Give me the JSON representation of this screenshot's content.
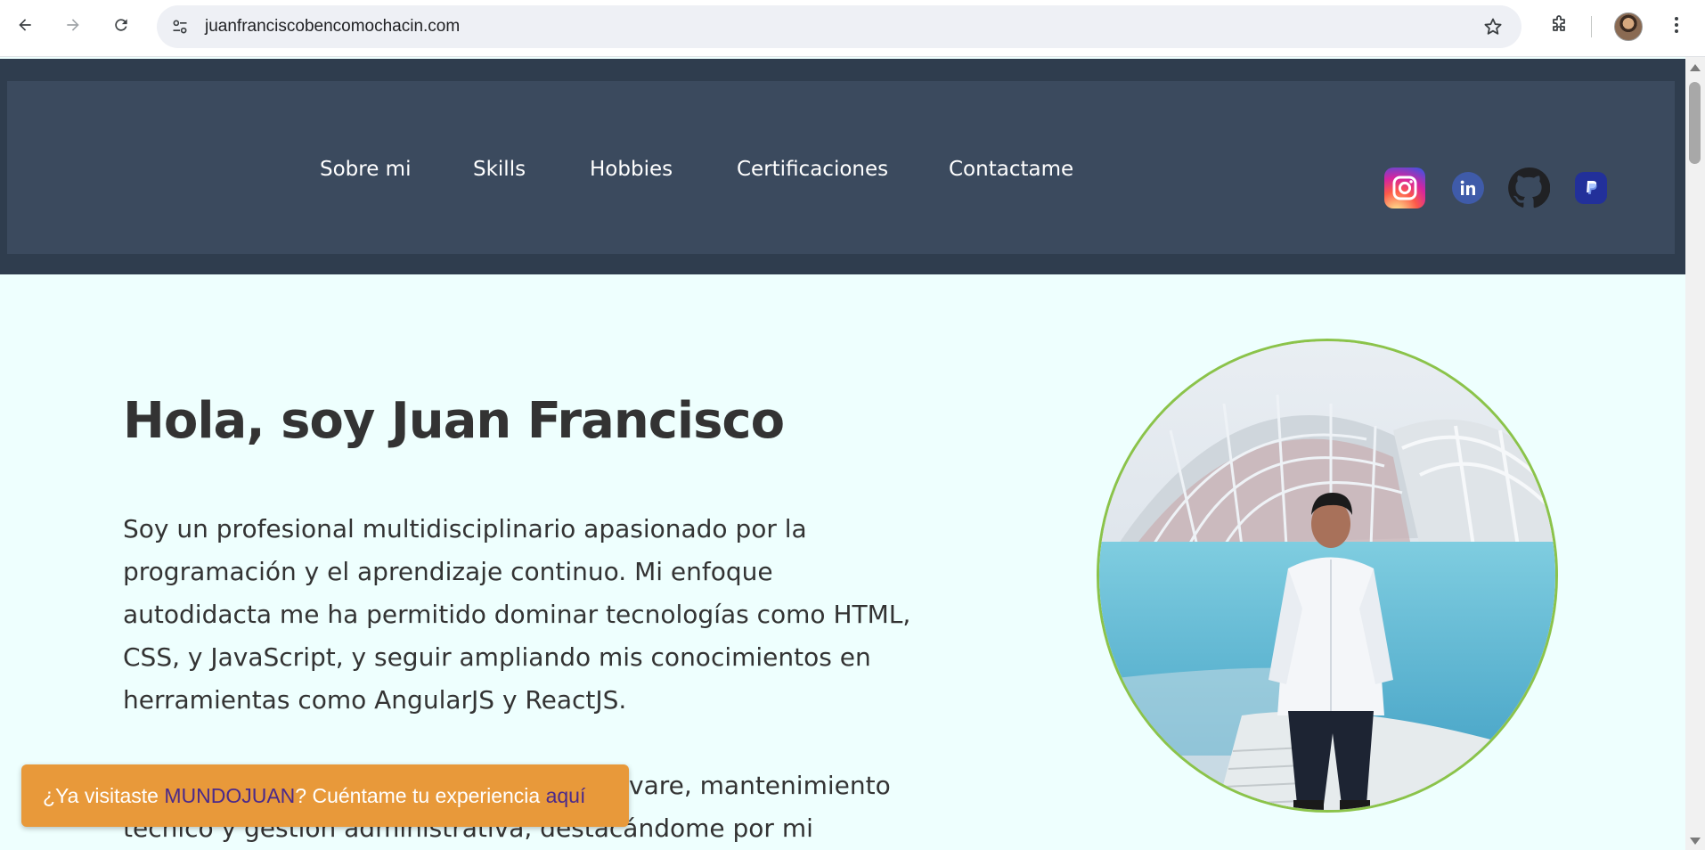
{
  "browser": {
    "url": "juanfranciscobencomochacin.com",
    "icons": [
      "back-arrow-icon",
      "forward-arrow-icon",
      "reload-icon",
      "site-settings-icon",
      "bookmark-star-icon",
      "extensions-puzzle-icon",
      "profile-avatar",
      "more-vert-icon"
    ]
  },
  "header": {
    "nav": [
      {
        "label": "Sobre mi"
      },
      {
        "label": "Skills"
      },
      {
        "label": "Hobbies"
      },
      {
        "label": "Certificaciones"
      },
      {
        "label": "Contactame"
      }
    ],
    "social": [
      "instagram-icon",
      "linkedin-icon",
      "github-icon",
      "paypal-icon"
    ],
    "colors": {
      "outer": "#2f3d4e",
      "inner": "#3b4a5e"
    }
  },
  "hero": {
    "title": "Hola, soy Juan Francisco",
    "paragraph1": "Soy un profesional multidisciplinario apasionado por la programación y el aprendizaje continuo. Mi enfoque autodidacta me ha permitido dominar tecnologías como HTML, CSS, y JavaScript, y seguir ampliando mis conocimientos en herramientas como AngularJS y ReactJS.",
    "paragraph2_visible": "vare, mantenimiento técnico y gestión administrativa, destacándome por mi"
  },
  "banner": {
    "prefix": "¿Ya visitaste ",
    "brand": "MUNDOJUAN",
    "middle": "? Cuéntame tu experiencia ",
    "link": "aquí",
    "color": "#e8993a"
  },
  "accent": {
    "portrait_border": "#8bc34a",
    "page_bg": "#eefffe"
  }
}
